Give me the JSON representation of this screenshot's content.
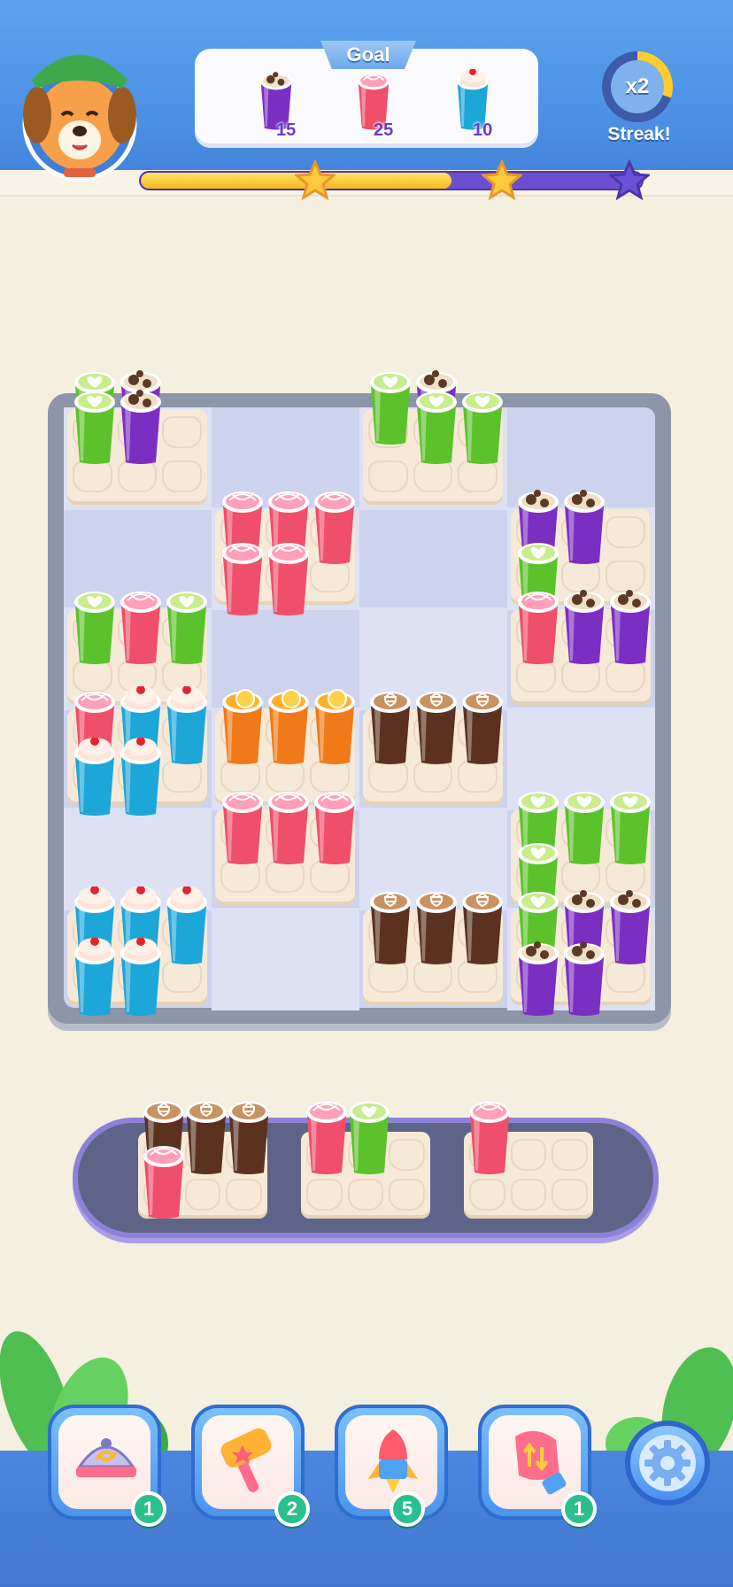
{
  "header": {
    "goal_title": "Goal",
    "goals": [
      {
        "drink": "chocolate",
        "count": "15"
      },
      {
        "drink": "strawberry",
        "count": "25"
      },
      {
        "drink": "cherry",
        "count": "10"
      }
    ],
    "streak_multiplier": "x2",
    "streak_label": "Streak!",
    "progress_fraction": 0.62,
    "stars": [
      "earned",
      "earned",
      "pending"
    ]
  },
  "boosters": [
    {
      "name": "shuffle",
      "icon": "shuffle-tray-icon",
      "count": "1"
    },
    {
      "name": "hammer",
      "icon": "hammer-icon",
      "count": "2"
    },
    {
      "name": "rocket",
      "icon": "rocket-icon",
      "count": "5"
    },
    {
      "name": "swap",
      "icon": "swap-glove-icon",
      "count": "1"
    }
  ],
  "settings_icon": "gear-icon",
  "colors": {
    "accent": "#4c8fe4",
    "board": "#cdd3ec",
    "tray": "#f6e9d8",
    "holder": "#5e6488",
    "badge": "#2bbf8d"
  },
  "drinks": {
    "matcha": {
      "body": "#5cc22c",
      "top": "#c9ec8d"
    },
    "chocolate": {
      "body": "#7b2fc2",
      "top": "#f0dfc7"
    },
    "strawberry": {
      "body": "#ef4f6a",
      "top": "#ff9fb9"
    },
    "cherry": {
      "body": "#1da6d8",
      "top": "#ffe4d8"
    },
    "orange": {
      "body": "#f07a17",
      "top": "#ffb02a"
    },
    "coffee": {
      "body": "#5b3220",
      "top": "#c99263"
    }
  },
  "board": {
    "cols": 4,
    "rows": 6,
    "trays": [
      {
        "c": 0,
        "r": 0,
        "cups": [
          "matcha",
          "chocolate",
          "",
          ""
        ],
        "upper": [
          "matcha",
          "chocolate"
        ]
      },
      {
        "c": 2,
        "r": 0,
        "cups": [
          "",
          "matcha",
          "matcha",
          ""
        ],
        "upper": [
          "matcha",
          "chocolate"
        ]
      },
      {
        "c": 1,
        "r": 1,
        "cups": [
          "strawberry",
          "strawberry",
          "strawberry",
          "strawberry",
          "strawberry"
        ]
      },
      {
        "c": 3,
        "r": 1,
        "cups": [
          "chocolate",
          "chocolate",
          "",
          "matcha"
        ]
      },
      {
        "c": 0,
        "r": 2,
        "cups": [
          "matcha",
          "strawberry",
          "matcha"
        ]
      },
      {
        "c": 3,
        "r": 2,
        "cups": [
          "strawberry",
          "chocolate",
          "chocolate"
        ]
      },
      {
        "c": 0,
        "r": 3,
        "cups": [
          "strawberry",
          "cherry",
          "cherry",
          "cherry",
          "cherry"
        ]
      },
      {
        "c": 1,
        "r": 3,
        "cups": [
          "orange",
          "orange",
          "orange"
        ]
      },
      {
        "c": 2,
        "r": 3,
        "cups": [
          "coffee",
          "coffee",
          "coffee"
        ]
      },
      {
        "c": 1,
        "r": 4,
        "cups": [
          "strawberry",
          "strawberry",
          "strawberry"
        ]
      },
      {
        "c": 3,
        "r": 4,
        "cups": [
          "matcha",
          "matcha",
          "matcha",
          "matcha"
        ]
      },
      {
        "c": 0,
        "r": 5,
        "cups": [
          "cherry",
          "cherry",
          "cherry",
          "cherry",
          "cherry"
        ]
      },
      {
        "c": 2,
        "r": 5,
        "cups": [
          "coffee",
          "coffee",
          "coffee"
        ]
      },
      {
        "c": 3,
        "r": 5,
        "cups": [
          "matcha",
          "chocolate",
          "chocolate",
          "chocolate",
          "chocolate"
        ]
      }
    ]
  },
  "holder": {
    "trays": [
      {
        "cups": [
          "coffee",
          "coffee",
          "coffee",
          "strawberry"
        ]
      },
      {
        "cups": [
          "strawberry",
          "matcha"
        ]
      },
      {
        "cups": [
          "strawberry"
        ]
      }
    ]
  }
}
